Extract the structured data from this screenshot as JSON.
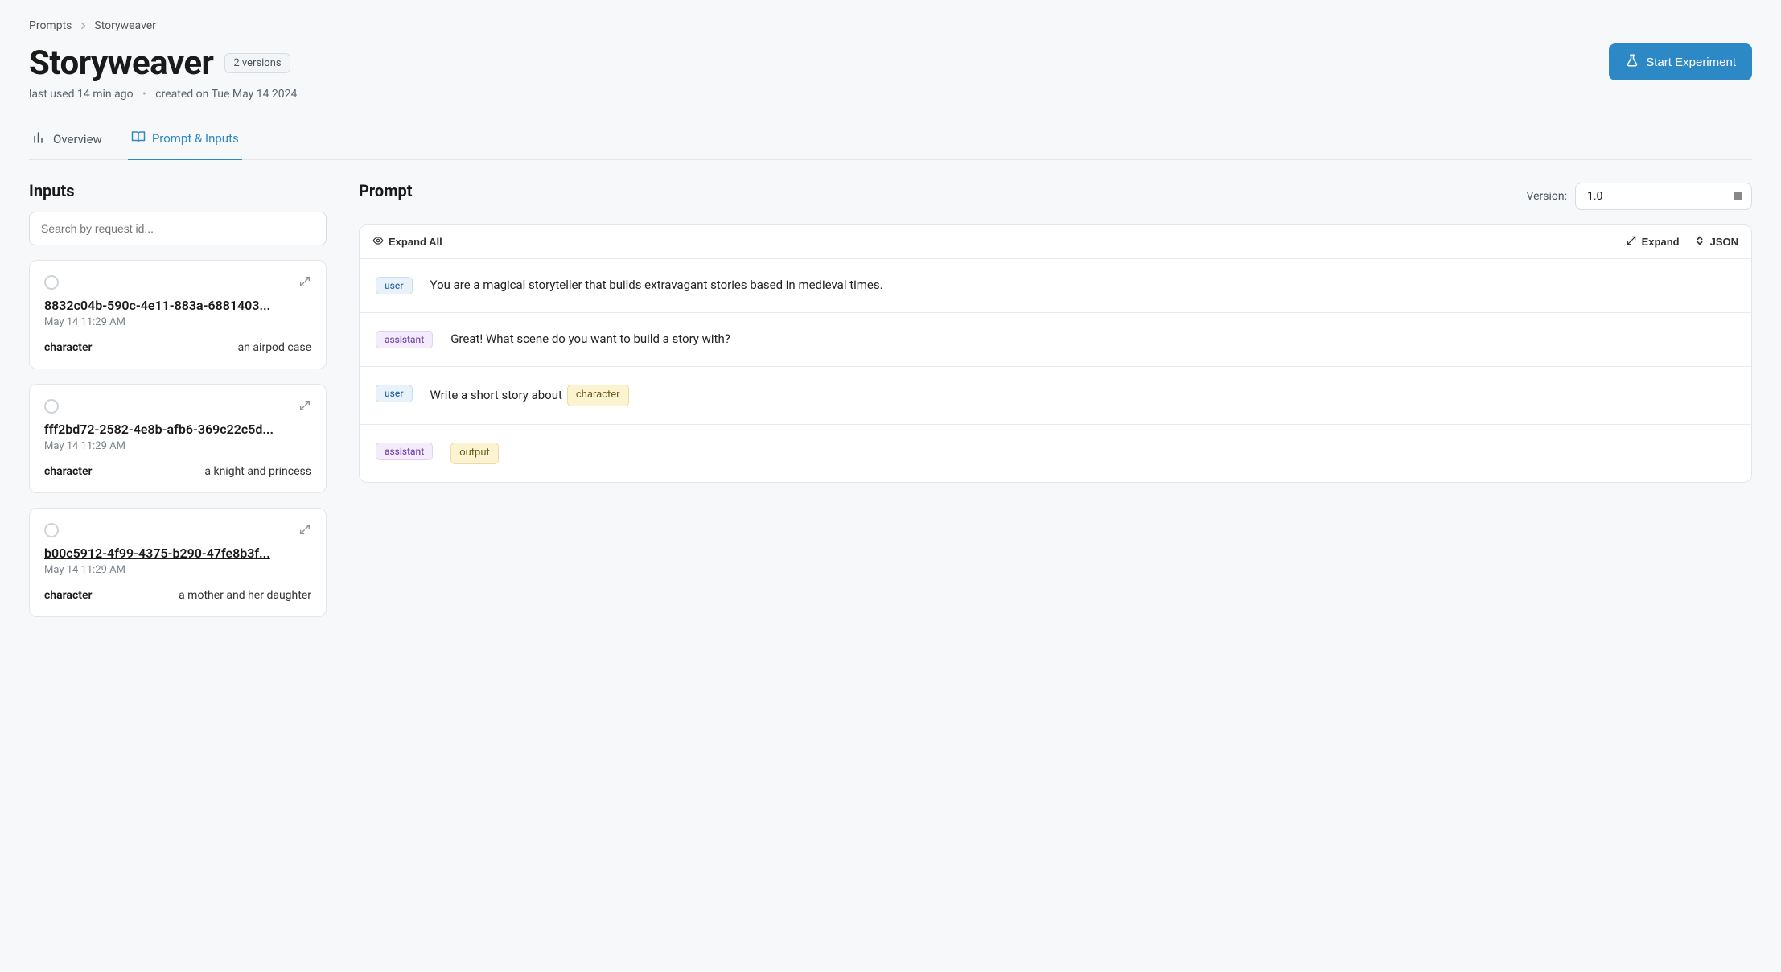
{
  "breadcrumb": {
    "root": "Prompts",
    "current": "Storyweaver"
  },
  "title": "Storyweaver",
  "versions_badge": "2 versions",
  "start_button": "Start Experiment",
  "meta": {
    "last_used": "last used 14 min ago",
    "created": "created on Tue May 14 2024"
  },
  "tabs": {
    "overview": "Overview",
    "prompt_inputs": "Prompt & Inputs"
  },
  "inputs_section": {
    "title": "Inputs",
    "search_placeholder": "Search by request id...",
    "items": [
      {
        "id": "8832c04b-590c-4e11-883a-6881403...",
        "date": "May 14 11:29 AM",
        "key": "character",
        "value": "an airpod case"
      },
      {
        "id": "fff2bd72-2582-4e8b-afb6-369c22c5d...",
        "date": "May 14 11:29 AM",
        "key": "character",
        "value": "a knight and princess"
      },
      {
        "id": "b00c5912-4f99-4375-b290-47fe8b3f...",
        "date": "May 14 11:29 AM",
        "key": "character",
        "value": "a mother and her daughter"
      }
    ]
  },
  "prompt_section": {
    "title": "Prompt",
    "version_label": "Version:",
    "version_value": "1.0",
    "toolbar": {
      "expand_all": "Expand All",
      "expand": "Expand",
      "json": "JSON"
    },
    "messages": [
      {
        "role": "user",
        "text": "You are a magical storyteller that builds extravagant stories based in medieval times."
      },
      {
        "role": "assistant",
        "text": "Great! What scene do you want to build a story with?"
      },
      {
        "role": "user",
        "text_prefix": "Write a short story about",
        "variable": "character"
      },
      {
        "role": "assistant",
        "variable": "output"
      }
    ]
  }
}
